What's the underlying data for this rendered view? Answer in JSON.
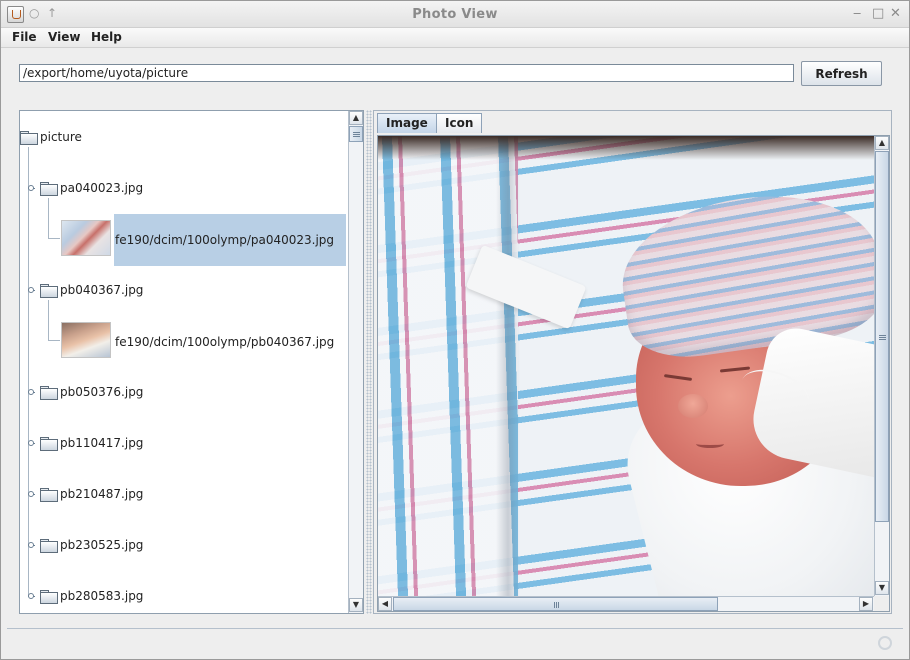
{
  "window": {
    "title": "Photo View",
    "title_icon": "pin-icon",
    "up_icon": "up-arrow-icon",
    "controls": {
      "minimize": "‒",
      "maximize": "□",
      "close": "✕"
    }
  },
  "menu": {
    "items": [
      {
        "label": "File"
      },
      {
        "label": "View"
      },
      {
        "label": "Help"
      }
    ]
  },
  "path_bar": {
    "value": "/export/home/uyota/picture",
    "refresh_label": "Refresh"
  },
  "tree": {
    "root": "picture",
    "nodes": [
      {
        "label": "pa040023.jpg",
        "expanded": true,
        "child": {
          "label": "fe190/dcim/100olymp/pa040023.jpg",
          "selected": true
        }
      },
      {
        "label": "pb040367.jpg",
        "expanded": true,
        "child": {
          "label": "fe190/dcim/100olymp/pb040367.jpg",
          "selected": false
        }
      },
      {
        "label": "pb050376.jpg",
        "expanded": false
      },
      {
        "label": "pb110417.jpg",
        "expanded": false
      },
      {
        "label": "pb210487.jpg",
        "expanded": false
      },
      {
        "label": "pb230525.jpg",
        "expanded": false
      },
      {
        "label": "pb280583.jpg",
        "expanded": false
      }
    ]
  },
  "tabs": [
    {
      "label": "Image",
      "active": true
    },
    {
      "label": "Icon",
      "active": false
    }
  ],
  "colors": {
    "selection": "#b8cfe5",
    "border": "#8f9fae",
    "background": "#eeeeee"
  }
}
